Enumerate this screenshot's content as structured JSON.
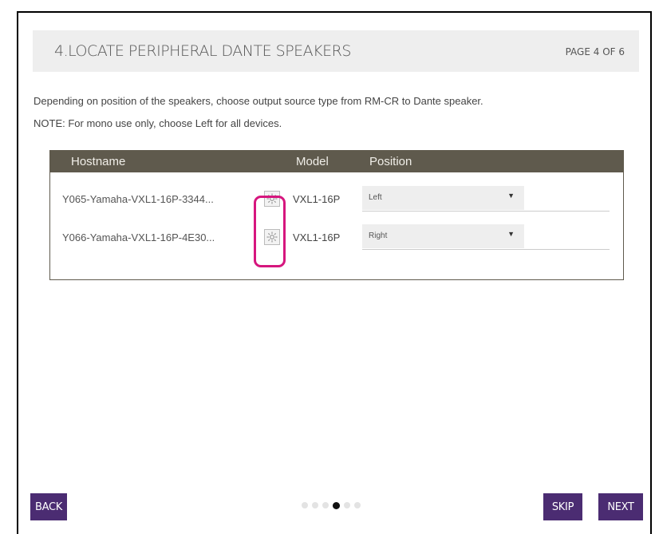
{
  "header": {
    "title": "4.LOCATE PERIPHERAL DANTE SPEAKERS",
    "page": "PAGE 4 OF 6"
  },
  "instructions": {
    "line1": "Depending on position of the speakers, choose output source type from RM-CR to Dante speaker.",
    "line2": "NOTE: For mono use only, choose Left for all devices."
  },
  "table": {
    "columns": {
      "hostname": "Hostname",
      "model": "Model",
      "position": "Position"
    },
    "rows": [
      {
        "hostname": "Y065-Yamaha-VXL1-16P-3344...",
        "model": "VXL1-16P",
        "position": "Left"
      },
      {
        "hostname": "Y066-Yamaha-VXL1-16P-4E30...",
        "model": "VXL1-16P",
        "position": "Right"
      }
    ]
  },
  "icons": {
    "locate": "locate-light-icon",
    "dropdown": "caret-down-icon"
  },
  "pagination": {
    "total": 6,
    "current": 4
  },
  "buttons": {
    "back": "BACK",
    "skip": "SKIP",
    "next": "NEXT"
  },
  "colors": {
    "accent": "#4b2c72",
    "table_header": "#5f5a4d",
    "highlight": "#d6167e"
  }
}
